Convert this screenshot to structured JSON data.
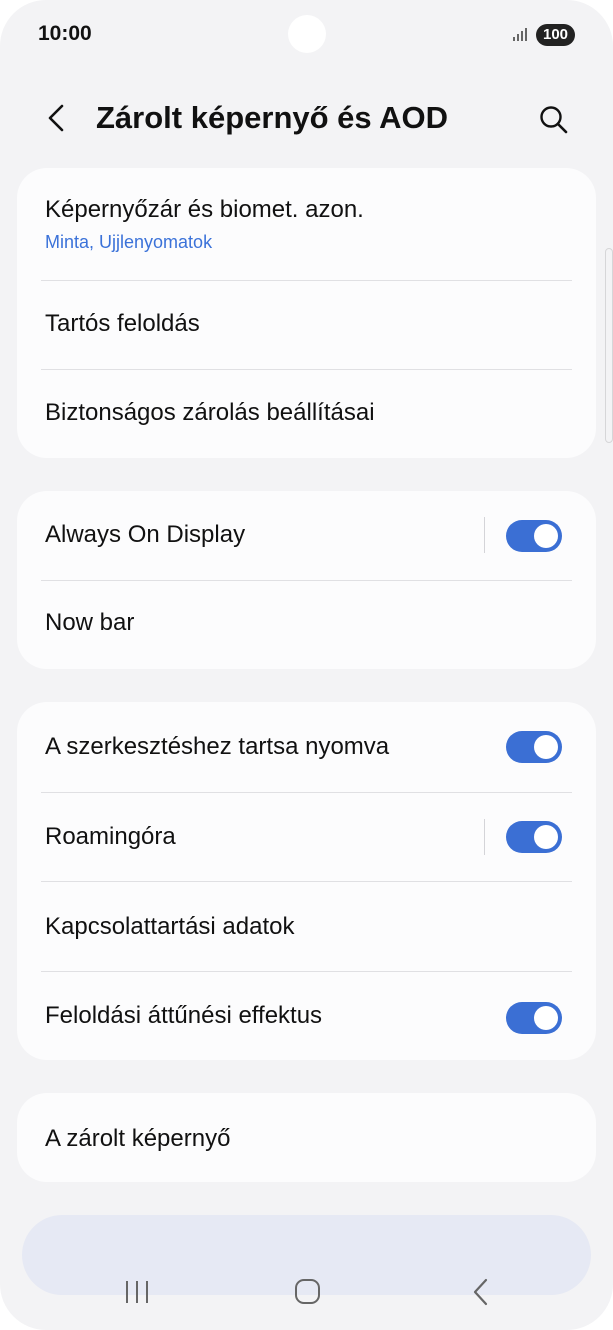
{
  "status_bar": {
    "time": "10:00",
    "battery": "100",
    "signal_icon": "signal-bars-icon"
  },
  "header": {
    "title": "Zárolt képernyő és AOD",
    "back_icon": "back-chevron-icon",
    "search_icon": "search-icon"
  },
  "groups": [
    {
      "items": [
        {
          "label": "Képernyőzár és biomet. azon.",
          "sublabel": "Minta, Ujjlenyomatok"
        },
        {
          "label": "Tartós feloldás"
        },
        {
          "label": "Biztonságos zárolás beállításai"
        }
      ]
    },
    {
      "items": [
        {
          "label": "Always On Display",
          "toggle": true
        },
        {
          "label": "Now bar"
        }
      ]
    },
    {
      "items": [
        {
          "label": "A szerkesztéshez tartsa nyomva",
          "toggle": true
        },
        {
          "label": "Roamingóra",
          "toggle": true
        },
        {
          "label": "Kapcsolattartási adatok"
        },
        {
          "label": "Feloldási áttűnési effektus",
          "toggle": true
        }
      ]
    },
    {
      "items": [
        {
          "label": "A zárolt képernyő"
        }
      ]
    }
  ],
  "nav_bar": {
    "recents_icon": "recents-icon",
    "home_icon": "home-icon",
    "back_icon": "back-icon"
  },
  "colors": {
    "accent": "#3b6fd4",
    "sublabel": "#3b72d9",
    "background": "#f3f3f5",
    "card": "#fcfcfd"
  }
}
